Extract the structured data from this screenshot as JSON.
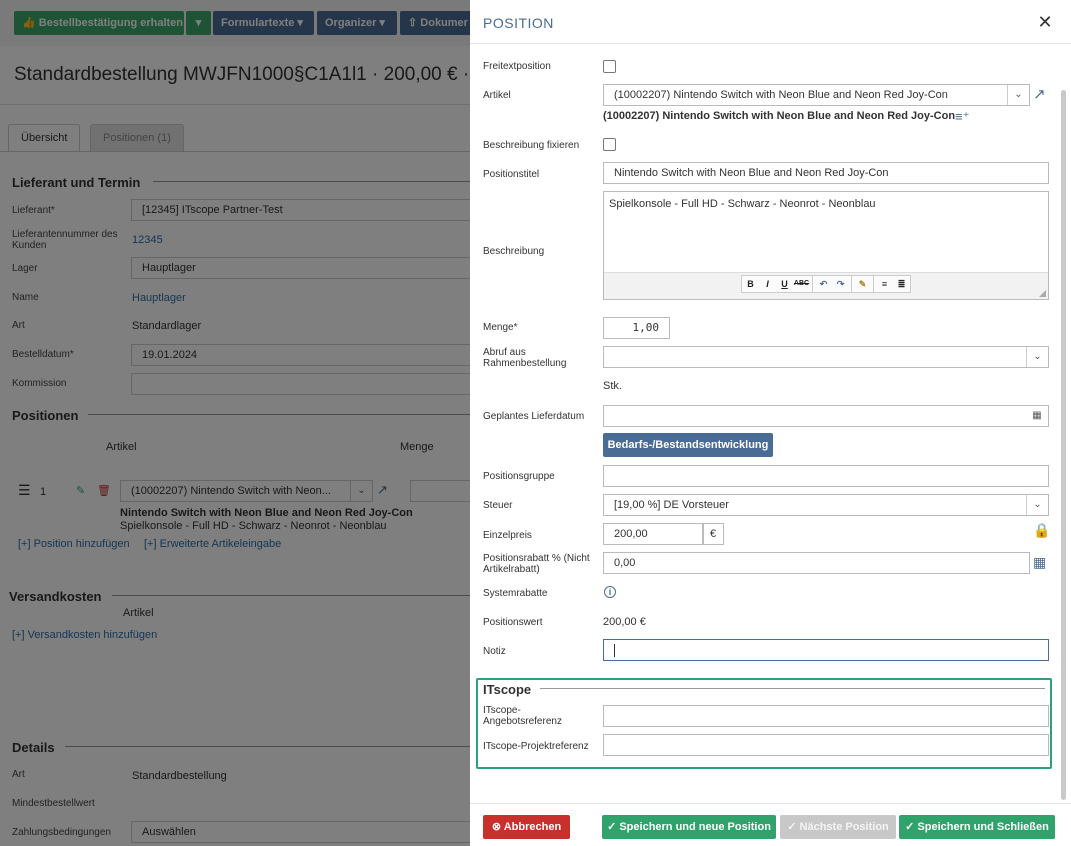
{
  "background": {
    "toolbar": {
      "confirm_label": "Bestellbestätigung erhalten",
      "forms_label": "Formulartexte",
      "organizer_label": "Organizer",
      "documents_label": "Dokumer"
    },
    "page_title": "Standardbestellung MWJFN1000§C1A1l1 · 200,00 € ·",
    "tabs": [
      "Übersicht",
      "Positionen (1)"
    ],
    "supplier_section": "Lieferant und Termin",
    "fields": {
      "supplier_label": "Lieferant*",
      "supplier_value": "[12345] ITscope Partner-Test",
      "customer_no_label": "Lieferantennummer des Kunden",
      "customer_no_value": "12345",
      "warehouse_label": "Lager",
      "warehouse_value": "Hauptlager",
      "name_label": "Name",
      "name_value": "Hauptlager",
      "type_label": "Art",
      "type_value": "Standardlager",
      "order_date_label": "Bestelldatum*",
      "order_date_value": "19.01.2024",
      "commission_label": "Kommission"
    },
    "positions_section": "Positionen",
    "positions_cols": {
      "article": "Artikel",
      "quantity": "Menge"
    },
    "position_row": {
      "index": "1",
      "article_select": "(10002207) Nintendo Switch with Neon...",
      "title": "Nintendo Switch with Neon Blue and Neon Red Joy-Con",
      "desc": "Spielkonsole - Full HD - Schwarz - Neonrot - Neonblau"
    },
    "add_position_link": "[+] Position hinzufügen",
    "extended_entry_link": "[+] Erweiterte Artikeleingabe",
    "shipping_section": "Versandkosten",
    "shipping_col": "Artikel",
    "add_shipping_link": "[+] Versandkosten hinzufügen",
    "details_section": "Details",
    "details": {
      "type_label": "Art",
      "type_value": "Standardbestellung",
      "min_value_label": "Mindestbestellwert",
      "payment_label": "Zahlungsbedingungen",
      "payment_value": "Auswählen"
    }
  },
  "modal": {
    "title": "POSITION",
    "freetext_label": "Freitextposition",
    "article_label": "Artikel",
    "article_value": "(10002207) Nintendo Switch with Neon Blue and Neon Red Joy-Con",
    "article_bold": "(10002207) Nintendo Switch with Neon Blue and Neon Red Joy-Con",
    "fix_desc_label": "Beschreibung fixieren",
    "pos_title_label": "Positionstitel",
    "pos_title_value": "Nintendo Switch with Neon Blue and Neon Red Joy-Con",
    "desc_label": "Beschreibung",
    "desc_value": "Spielkonsole - Full HD - Schwarz - Neonrot - Neonblau",
    "rte": {
      "bold": "B",
      "italic": "I",
      "underline": "U",
      "strike": "ABC"
    },
    "quantity_label": "Menge*",
    "quantity_value": "1,00",
    "call_off_label": "Abruf aus Rahmenbestellung",
    "unit": "Stk.",
    "delivery_label": "Geplantes Lieferdatum",
    "demand_button": "Bedarfs-/Bestandsentwicklung",
    "group_label": "Positionsgruppe",
    "tax_label": "Steuer",
    "tax_value": "[19,00 %] DE Vorsteuer",
    "unit_price_label": "Einzelpreis",
    "unit_price_value": "200,00",
    "currency": "€",
    "discount_label": "Positionsrabatt % (Nicht Artikelrabatt)",
    "discount_value": "0,00",
    "system_discount_label": "Systemrabatte",
    "position_value_label": "Positionswert",
    "position_value": "200,00 €",
    "note_label": "Notiz",
    "itscope_section": "ITscope",
    "itscope_offer_label": "ITscope-Angebotsreferenz",
    "itscope_project_label": "ITscope-Projektreferenz",
    "buttons": {
      "cancel": "Abbrechen",
      "save_new": "Speichern und neue Position",
      "next": "Nächste Position",
      "save_close": "Speichern und Schließen"
    }
  },
  "colors": {
    "primary": "#4a6b94",
    "success": "#2fa36b",
    "danger": "#c9302c",
    "highlight_border": "#2aa37a"
  }
}
